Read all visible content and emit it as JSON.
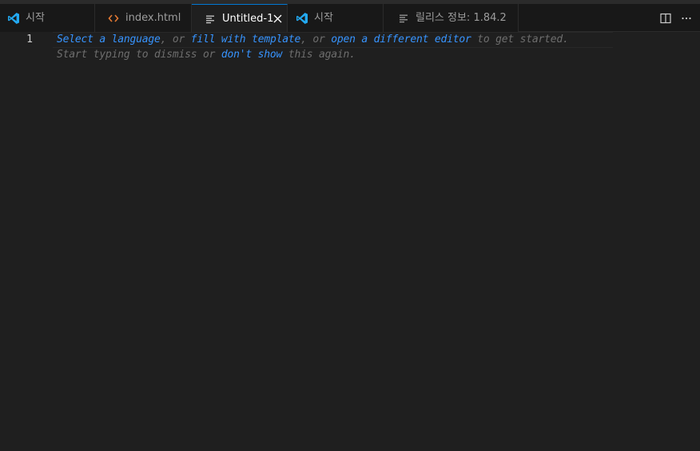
{
  "tabs": [
    {
      "label": "시작",
      "icon": "vscode-logo-icon",
      "active": false
    },
    {
      "label": "index.html",
      "icon": "html-code-icon",
      "active": false
    },
    {
      "label": "Untitled-1",
      "icon": "text-file-icon",
      "active": true
    },
    {
      "label": "시작",
      "icon": "vscode-logo-icon",
      "active": false
    },
    {
      "label": "릴리스 정보: 1.84.2",
      "icon": "release-notes-icon",
      "active": false
    }
  ],
  "actions": {
    "split_editor_icon": "split-editor-icon",
    "more_actions_icon": "ellipsis-icon"
  },
  "editor": {
    "line_number": "1",
    "hint_line1": {
      "link1": "Select a language",
      "sep1": ", or ",
      "link2": "fill with template",
      "sep2": ", or ",
      "link3": "open a different editor",
      "tail": " to get started."
    },
    "hint_line2": {
      "text1": "Start typing to dismiss or ",
      "link": "don't show",
      "tail": " this again."
    }
  },
  "colors": {
    "accent": "#0078d4",
    "link": "#3794ff",
    "vscode_blue": "#23a9f2",
    "html_orange": "#e37933"
  }
}
